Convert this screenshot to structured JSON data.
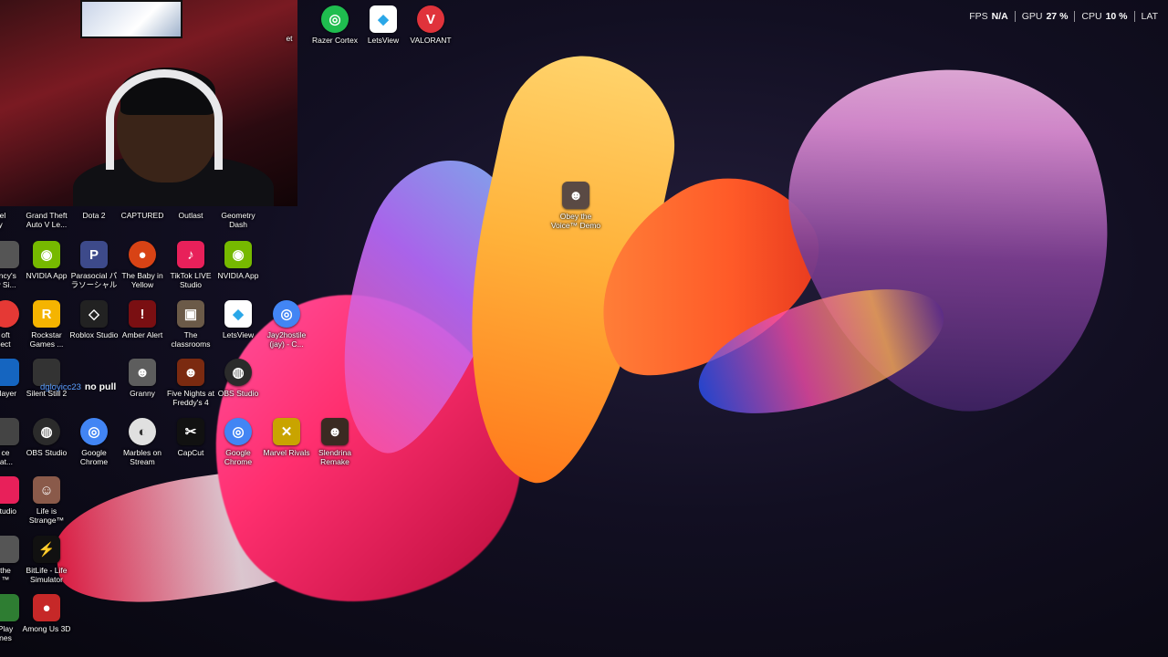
{
  "overlay": {
    "fps": {
      "label": "FPS",
      "value": "N/A"
    },
    "gpu": {
      "label": "GPU",
      "value": "27 %"
    },
    "cpu": {
      "label": "CPU",
      "value": "10 %"
    },
    "lat": {
      "label": "LAT",
      "value": ""
    }
  },
  "top_icons": [
    {
      "label": "Razer Cortex",
      "icon": "razer-cortex-icon",
      "color": "#1fbd4f"
    },
    {
      "label": "LetsView",
      "icon": "letsview-icon",
      "color": "#2aa7e8"
    },
    {
      "label": "VALORANT",
      "icon": "valorant-icon",
      "color": "#e0333b"
    }
  ],
  "top_partial": "et",
  "row_games": [
    {
      "label": "rmel\nrty"
    },
    {
      "label": "Grand Theft Auto V Le..."
    },
    {
      "label": "Dota 2"
    },
    {
      "label": "CAPTURED"
    },
    {
      "label": "Outlast"
    },
    {
      "label": "Geometry Dash"
    }
  ],
  "desktop": {
    "row2": [
      {
        "label": "ancy's\nw Si...",
        "color": "#555"
      },
      {
        "label": "NVIDIA App",
        "color": "#76b900"
      },
      {
        "label": "Parasocial パラソーシャル",
        "color": "#3d4a8a"
      },
      {
        "label": "The Baby in Yellow",
        "color": "#d84315"
      },
      {
        "label": "TikTok LIVE Studio",
        "color": "#e8205a"
      },
      {
        "label": "NVIDIA App",
        "color": "#76b900"
      }
    ],
    "row3": [
      {
        "label": "oft\nect",
        "color": "#e53935"
      },
      {
        "label": "Rockstar Games ...",
        "color": "#f5b400"
      },
      {
        "label": "Roblox Studio",
        "color": "#222"
      },
      {
        "label": "Amber Alert",
        "color": "#7a0f12"
      },
      {
        "label": "The classrooms",
        "color": "#6b5a48"
      },
      {
        "label": "LetsView",
        "color": "#2aa7e8"
      },
      {
        "label": "Jay2hostile (jay) - C...",
        "color": "#4285f4"
      }
    ],
    "row4": [
      {
        "label": "Player",
        "color": "#1565c0"
      },
      {
        "label": "Silent Still 2",
        "color": "#333"
      },
      {
        "label": "Granny",
        "color": "#5d5d5d"
      },
      {
        "label": "Five Nights at Freddy's 4",
        "color": "#7b2a10"
      },
      {
        "label": "OBS Studio",
        "color": "#2b2b2b"
      }
    ],
    "row5": [
      {
        "label": "ce\nlat...",
        "color": "#444"
      },
      {
        "label": "OBS Studio",
        "color": "#2b2b2b"
      },
      {
        "label": "Google Chrome",
        "color": "#4285f4"
      },
      {
        "label": "Marbles on Stream",
        "color": "#e0e0e0"
      },
      {
        "label": "CapCut",
        "color": "#111"
      },
      {
        "label": "Google Chrome",
        "color": "#4285f4"
      },
      {
        "label": "Marvel Rivals",
        "color": "#c9a400"
      },
      {
        "label": "Slendrina Remake",
        "color": "#3a2a22"
      }
    ],
    "row6": [
      {
        "label": "Studio",
        "color": "#e8205a"
      },
      {
        "label": "Life is Strange™",
        "color": "#8a5a4a"
      }
    ],
    "row7": [
      {
        "label": "the\n™",
        "color": "#555"
      },
      {
        "label": "BitLife - Life Simulator",
        "color": "#111"
      }
    ],
    "row8": [
      {
        "label": "Play\nnes",
        "color": "#2e7d32"
      },
      {
        "label": "Among Us 3D",
        "color": "#c62828"
      }
    ],
    "center_icon": {
      "label": "Obey the Voice™ Demo",
      "color": "#5a4a44"
    }
  },
  "chat": {
    "user": "dgloyicc23",
    "message": "no pull"
  }
}
